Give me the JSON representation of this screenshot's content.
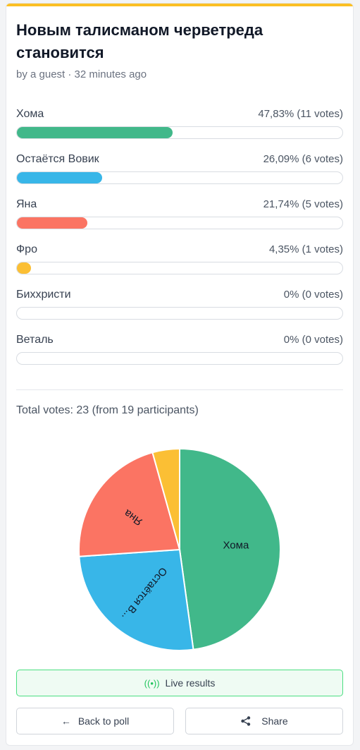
{
  "poll": {
    "title": "Новым талисманом черветреда становится",
    "meta": "by a guest · 32 minutes ago",
    "total": "Total votes: 23 (from 19 participants)"
  },
  "options": [
    {
      "label": "Хома",
      "stat": "47,83% (11 votes)",
      "pct": 47.83,
      "color": "#41b88a"
    },
    {
      "label": "Остаётся Вовик",
      "stat": "26,09% (6 votes)",
      "pct": 26.09,
      "color": "#38b6e8"
    },
    {
      "label": "Яна",
      "stat": "21,74% (5 votes)",
      "pct": 21.74,
      "color": "#fb7463"
    },
    {
      "label": "Фро",
      "stat": "4,35% (1 votes)",
      "pct": 4.35,
      "color": "#fbbf34"
    },
    {
      "label": "Биххристи",
      "stat": "0% (0 votes)",
      "pct": 0,
      "color": "#9ca3af"
    },
    {
      "label": "Веталь",
      "stat": "0% (0 votes)",
      "pct": 0,
      "color": "#9ca3af"
    }
  ],
  "chart_data": {
    "type": "pie",
    "categories": [
      "Хома",
      "Остаётся Вовик",
      "Яна",
      "Фро",
      "Биххристи",
      "Веталь"
    ],
    "values": [
      11,
      6,
      5,
      1,
      0,
      0
    ],
    "slice_labels": [
      "Хома",
      "Остаётся В...",
      "Яна",
      "",
      "",
      ""
    ],
    "colors": [
      "#41b88a",
      "#38b6e8",
      "#fb7463",
      "#fbbf34",
      "#9ca3af",
      "#9ca3af"
    ]
  },
  "actions": {
    "live": "Live results",
    "live_icon": "broadcast-icon",
    "back": "Back to poll",
    "back_icon": "arrow-left-icon",
    "share": "Share",
    "share_icon": "share-icon"
  }
}
